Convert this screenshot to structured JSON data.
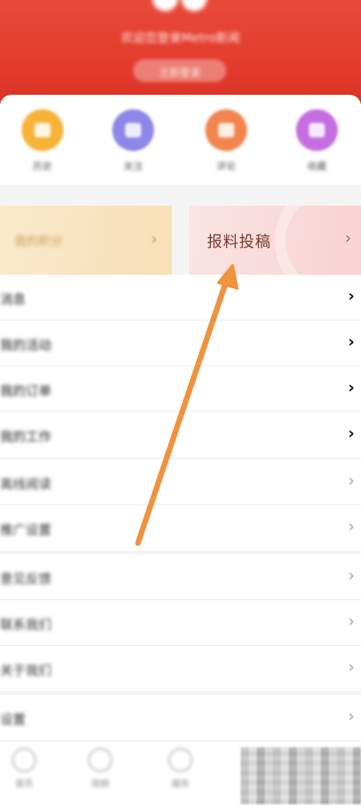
{
  "header": {
    "username": "欢迎您登录Metro新闻",
    "login_button": "立即登录"
  },
  "quick_actions": [
    {
      "label": "历史",
      "icon": "history-icon",
      "color": "#f7b338"
    },
    {
      "label": "关注",
      "icon": "follow-icon",
      "color": "#8e86e8"
    },
    {
      "label": "评论",
      "icon": "comment-icon",
      "color": "#f2854e"
    },
    {
      "label": "收藏",
      "icon": "favorite-icon",
      "color": "#c46ee0"
    }
  ],
  "promos": {
    "left_label": "我的积分",
    "right_label": "报料投稿"
  },
  "list_group_1": [
    {
      "label": "消息"
    },
    {
      "label": "我的活动"
    },
    {
      "label": "我的订单"
    },
    {
      "label": "我的工作"
    }
  ],
  "list_group_2": [
    {
      "label": "离线阅读"
    },
    {
      "label": "推广设置"
    }
  ],
  "list_group_3": [
    {
      "label": "意见反馈"
    },
    {
      "label": "联系我们"
    },
    {
      "label": "关于我们"
    }
  ],
  "list_group_4": [
    {
      "label": "设置"
    }
  ],
  "bottom_nav": [
    {
      "label": "首页"
    },
    {
      "label": "视频"
    },
    {
      "label": "服务"
    }
  ],
  "annotation": {
    "color": "#f0923e"
  }
}
